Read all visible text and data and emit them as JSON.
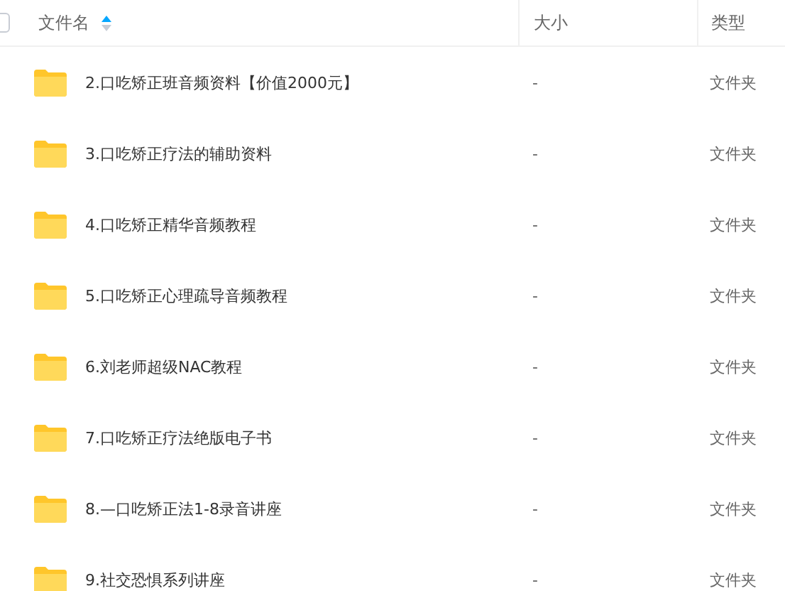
{
  "table": {
    "select_all": {
      "checked": false
    },
    "columns": [
      {
        "label": "文件名",
        "sort_ascending": true
      },
      {
        "label": "大小"
      },
      {
        "label": "类型"
      }
    ],
    "rows": [
      {
        "name": "2.口吃矫正班音频资料【价值2000元】",
        "size": "-",
        "type": "文件夹"
      },
      {
        "name": "3.口吃矫正疗法的辅助资料",
        "size": "-",
        "type": "文件夹"
      },
      {
        "name": "4.口吃矫正精华音频教程",
        "size": "-",
        "type": "文件夹"
      },
      {
        "name": "5.口吃矫正心理疏导音频教程",
        "size": "-",
        "type": "文件夹"
      },
      {
        "name": "6.刘老师超级NAC教程",
        "size": "-",
        "type": "文件夹"
      },
      {
        "name": "7.口吃矫正疗法绝版电子书",
        "size": "-",
        "type": "文件夹"
      },
      {
        "name": "8.—口吃矫正法1-8录音讲座",
        "size": "-",
        "type": "文件夹"
      },
      {
        "name": "9.社交恐惧系列讲座",
        "size": "-",
        "type": "文件夹"
      }
    ]
  }
}
